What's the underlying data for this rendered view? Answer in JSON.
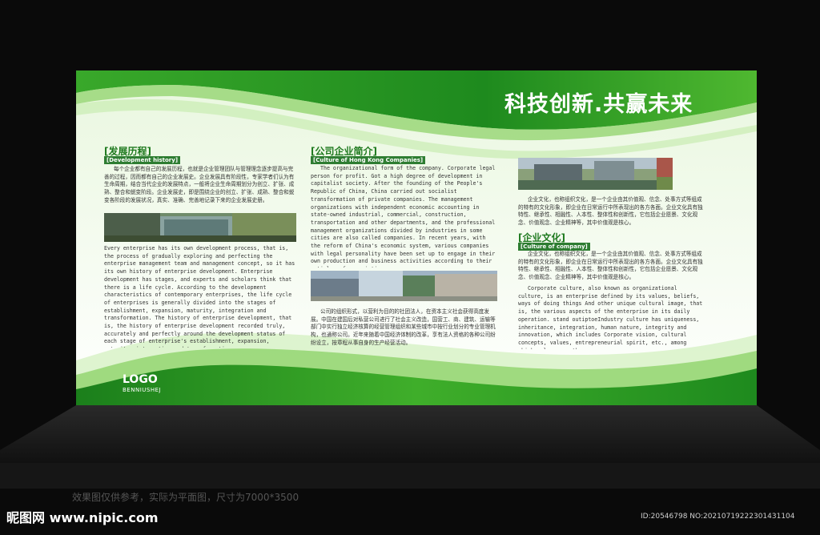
{
  "headline": "科技创新.共赢未来",
  "logo": {
    "text": "LOGO",
    "subtext": "BENNIUSHEJ"
  },
  "sections": {
    "history": {
      "title": "[发展历程]",
      "subtitle": "[Development history]",
      "body_zh": "每个企业都有自己的发展历程，也就是企业管理团队与管理理念逐步提高与完善的过程，因而都有自己的企业发展史。企业发展具有阶段性，专家学者们认为有生命周期，结合当代企业的发展特点，一般将企业生命周期划分为创立、扩张、成熟、整合和蜕变阶段。企业发展史，即是围绕企业的创立、扩张、成熟、整合和蜕变各阶段的发展状况，真实、准确、完善地记录下来的企业发展史册。",
      "body_en": "Every enterprise has its own development process, that is, the process of gradually exploring and perfecting the enterprise management team and management concept, so it has its own history of enterprise development. Enterprise development has stages, and experts and scholars think that there is a life cycle. According to the development characteristics of contemporary enterprises, the life cycle of enterprises is generally divided into the stages of establishment, expansion, maturity, integration and transformation. The history of enterprise development, that is, the history of enterprise development recorded truly, accurately and perfectly around the development status of each stage of enterprise's establishment, expansion, maturity, integration and transformation."
    },
    "company": {
      "title": "[公司企业简介]",
      "subtitle": "[Culture of Hong Kong Companies]",
      "body_en": "The organizational form of the company. Corporate legal person for profit. Got a high degree of development in capitalist society. After the founding of the People's Republic of China, China carried out socialist transformation of private companies. The management organizations with independent economic accounting in state-owned industrial, commercial, construction, transportation and other departments, and the professional management organizations divided by industries in some cities are also called companies. In recent years, with the reform of China's economic system, various companies with legal personality have been set up to engage in their own production and business activities according to their articles of association.",
      "body_zh": "公司的组织形式，以营利为目的的社团法人，在资本主义社会获得高度发展。中国在建国后对私营公司进行了社会主义改造，国营工、商、建筑、运输等部门中实行独立经济核算的经营管理组织和某些城市中按行业划分的专业管理机构，也通称公司。近年来随着中国经济体制的改革，享有法人资格的各种公司纷纷设立，按章程从事自身的生产经营活动。"
    },
    "culture": {
      "title": "[企业文化]",
      "subtitle": "[Culture of company]",
      "intro_zh": "企业文化，也称组织文化，是一个企业由其价值观、信念、处事方式等组成的特有的文化形象，即企业在日常运行中所表现出的各方各面。企业文化具有独特性、继承性、相融性、人本性、整体性和创新性，它包括企业愿景、文化观念、价值观念、企业精神等，其中价值观是核心。",
      "body_zh": "企业文化，也称组织文化，是一个企业由其价值观、信念、处事方式等组成的特有的文化形象，即企业在日常运行中所表现出的各方各面。企业文化具有独特性、继承性、相融性、人本性、整体性和创新性，它包括企业愿景、文化观念、价值观念、企业精神等，其中价值观是核心。",
      "body_en": "Corporate culture, also known as organizational culture, is an enterprise defined by its values, beliefs, ways of doing things And other unique cultural image, that is, the various aspects of the enterprise in its daily operation. stand outiptoeIndustry culture has uniqueness, inheritance, integration, human nature, integrity and innovation, which includes Corporate vision, cultural concepts, values, entrepreneurial spirit, etc., among which values are the core."
    }
  },
  "caption": "效果图仅供参考，实际为平面图，尺寸为7000*3500",
  "site_logo": "昵图网 www.nipic.com",
  "site_id": "ID:20546798 NO:20210719222301431104",
  "colors": {
    "green_dark": "#1e8a1e",
    "green_mid": "#3fae2a",
    "green_light": "#8fd36a",
    "title_green": "#1f7a1f",
    "background": "#0a0a0a"
  },
  "icons": [
    "building-photo",
    "glass-facade-photo",
    "pond-photo"
  ]
}
